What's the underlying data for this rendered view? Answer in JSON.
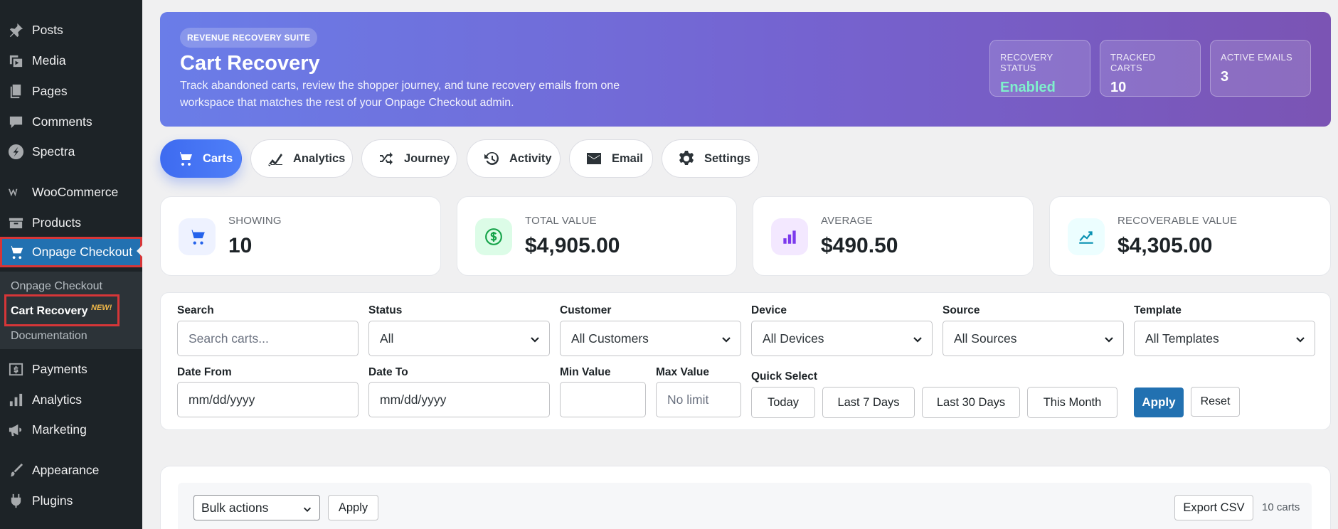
{
  "sidebar": {
    "items": [
      {
        "label": "Posts",
        "icon": "pin-icon"
      },
      {
        "label": "Media",
        "icon": "media-icon"
      },
      {
        "label": "Pages",
        "icon": "pages-icon"
      },
      {
        "label": "Comments",
        "icon": "comment-icon"
      },
      {
        "label": "Spectra",
        "icon": "spectra-icon"
      },
      {
        "label": "WooCommerce",
        "icon": "woocommerce-icon"
      },
      {
        "label": "Products",
        "icon": "products-icon"
      },
      {
        "label": "Onpage Checkout",
        "icon": "cart-icon"
      },
      {
        "label": "Payments",
        "icon": "payments-icon"
      },
      {
        "label": "Analytics",
        "icon": "analytics-icon"
      },
      {
        "label": "Marketing",
        "icon": "megaphone-icon"
      },
      {
        "label": "Appearance",
        "icon": "brush-icon"
      },
      {
        "label": "Plugins",
        "icon": "plugin-icon"
      }
    ],
    "submenu": [
      {
        "label": "Onpage Checkout"
      },
      {
        "label": "Cart Recovery"
      },
      {
        "label": "Documentation"
      }
    ],
    "new_badge": "NEW!"
  },
  "hero": {
    "pill": "REVENUE RECOVERY SUITE",
    "title": "Cart Recovery",
    "description": "Track abandoned carts, review the shopper journey, and tune recovery emails from one workspace that matches the rest of your Onpage Checkout admin.",
    "stats": [
      {
        "label": "RECOVERY STATUS",
        "value": "Enabled"
      },
      {
        "label": "TRACKED CARTS",
        "value": "10"
      },
      {
        "label": "ACTIVE EMAILS",
        "value": "3"
      }
    ]
  },
  "tabs": [
    {
      "label": "Carts",
      "icon": "cart-icon"
    },
    {
      "label": "Analytics",
      "icon": "chart-icon"
    },
    {
      "label": "Journey",
      "icon": "shuffle-icon"
    },
    {
      "label": "Activity",
      "icon": "history-icon"
    },
    {
      "label": "Email",
      "icon": "envelope-icon"
    },
    {
      "label": "Settings",
      "icon": "gear-icon"
    }
  ],
  "stats": [
    {
      "label": "SHOWING",
      "value": "10",
      "icon": "cart-icon",
      "color": "#2563eb",
      "bg": "#eef2ff"
    },
    {
      "label": "TOTAL VALUE",
      "value": "$4,905.00",
      "icon": "dollar-icon",
      "color": "#16a34a",
      "bg": "#dcfce7"
    },
    {
      "label": "AVERAGE",
      "value": "$490.50",
      "icon": "bar-chart-icon",
      "color": "#7c3aed",
      "bg": "#f3e8ff"
    },
    {
      "label": "RECOVERABLE VALUE",
      "value": "$4,305.00",
      "icon": "trend-icon",
      "color": "#0891b2",
      "bg": "#ecfeff"
    }
  ],
  "filters": {
    "search": {
      "label": "Search",
      "placeholder": "Search carts..."
    },
    "status": {
      "label": "Status",
      "value": "All"
    },
    "customer": {
      "label": "Customer",
      "value": "All Customers"
    },
    "device": {
      "label": "Device",
      "value": "All Devices"
    },
    "source": {
      "label": "Source",
      "value": "All Sources"
    },
    "template": {
      "label": "Template",
      "value": "All Templates"
    },
    "date_from": {
      "label": "Date From",
      "placeholder": "mm/dd/yyyy"
    },
    "date_to": {
      "label": "Date To",
      "placeholder": "mm/dd/yyyy"
    },
    "min_value": {
      "label": "Min Value",
      "placeholder": ""
    },
    "max_value": {
      "label": "Max Value",
      "placeholder": "No limit"
    },
    "quick_select": {
      "label": "Quick Select",
      "options": [
        "Today",
        "Last 7 Days",
        "Last 30 Days",
        "This Month"
      ]
    },
    "apply_label": "Apply",
    "reset_label": "Reset"
  },
  "table": {
    "bulk_actions": "Bulk actions",
    "apply_label": "Apply",
    "export_label": "Export CSV",
    "count": "10 carts"
  },
  "colors": {
    "accent": "#2271b1",
    "sidebar": "#1d2327",
    "tab_active": "#3e6bf0",
    "hero_start": "#6a7de8",
    "hero_end": "#7b54b4",
    "enabled": "#7ff0cc"
  }
}
